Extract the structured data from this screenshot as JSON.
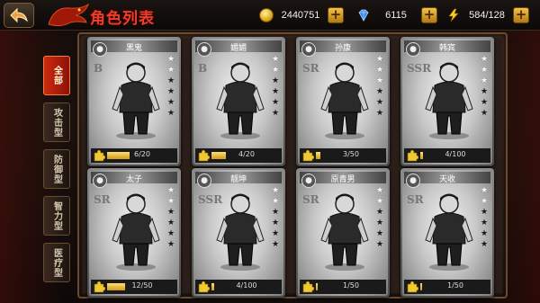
{
  "header": {
    "title": "角色列表",
    "gold": "2440751",
    "gems": "6115",
    "energy": "584/128",
    "plus_label": "+"
  },
  "tabs": [
    {
      "label": "全部",
      "active": true
    },
    {
      "label": "攻击型",
      "active": false
    },
    {
      "label": "防御型",
      "active": false
    },
    {
      "label": "智力型",
      "active": false
    },
    {
      "label": "医疗型",
      "active": false
    }
  ],
  "characters": [
    {
      "name": "黑鬼",
      "rank": "B",
      "stars": 2,
      "fragments": "6/20",
      "progress": 0.3
    },
    {
      "name": "媚媚",
      "rank": "B",
      "stars": 2,
      "fragments": "4/20",
      "progress": 0.2
    },
    {
      "name": "孙康",
      "rank": "SR",
      "stars": 3,
      "fragments": "3/50",
      "progress": 0.06
    },
    {
      "name": "韩宾",
      "rank": "SSR",
      "stars": 3,
      "fragments": "4/100",
      "progress": 0.04
    },
    {
      "name": "太子",
      "rank": "SR",
      "stars": 2,
      "fragments": "12/50",
      "progress": 0.24
    },
    {
      "name": "靓坤",
      "rank": "SSR",
      "stars": 2,
      "fragments": "4/100",
      "progress": 0.04
    },
    {
      "name": "原青男",
      "rank": "SR",
      "stars": 2,
      "fragments": "1/50",
      "progress": 0.02
    },
    {
      "name": "天收",
      "rank": "SR",
      "stars": 2,
      "fragments": "1/50",
      "progress": 0.02
    }
  ],
  "colors": {
    "accent": "#e8402a",
    "gold": "#f0c24a",
    "card_border": "#8a8a8a"
  },
  "icons": {
    "back": "back-arrow-icon",
    "gold": "gold-coin-icon",
    "gem": "diamond-icon",
    "energy": "lightning-icon",
    "fragment": "puzzle-piece-icon",
    "star": "star-icon"
  }
}
